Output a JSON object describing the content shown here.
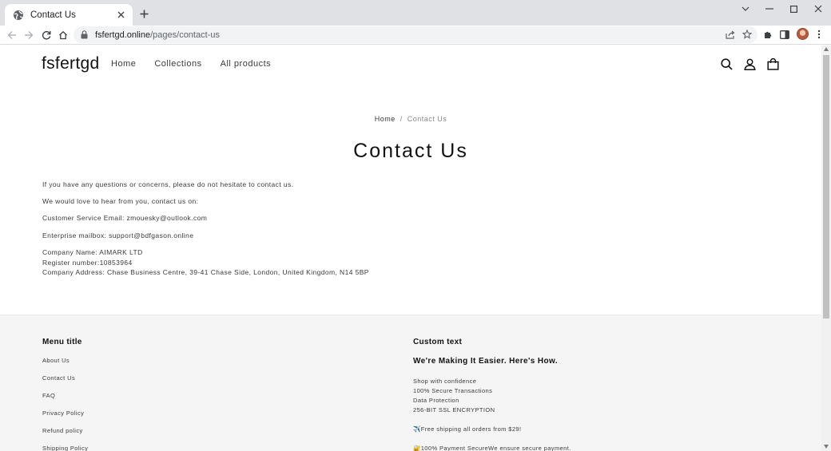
{
  "browser": {
    "tab_title": "Contact Us",
    "url_domain": "fsfertgd.online",
    "url_path": "/pages/contact-us"
  },
  "header": {
    "logo": "fsfertgd",
    "nav": [
      "Home",
      "Collections",
      "All products"
    ]
  },
  "breadcrumb": {
    "home": "Home",
    "separator": "/",
    "current": "Contact Us"
  },
  "page": {
    "title": "Contact Us",
    "paragraphs": [
      "If you have any questions or concerns, please do not hesitate to contact us.",
      "We would love to hear from you, contact us on:",
      "Customer Service Email: zmouesky@outlook.com",
      "Enterprise mailbox: support@bdfgason.online"
    ],
    "company": [
      "Company Name: AIMARK LTD",
      "Register number:10853964",
      "Company Address: Chase Business Centre, 39-41 Chase Side, London, United Kingdom, N14 5BP"
    ]
  },
  "footer": {
    "menu_title": "Menu title",
    "menu_items": [
      "About Us",
      "Contact Us",
      "FAQ",
      "Privacy Policy",
      "Refund policy",
      "Shipping Policy"
    ],
    "custom_title": "Custom text",
    "custom_heading": "We're Making It Easier. Here's How.",
    "custom_lines": [
      "Shop with confidence",
      "100% Secure Transactions",
      "Data Protection",
      "256-BIT SSL ENCRYPTION"
    ],
    "shipping_line": "✈️Free shipping all orders from $29!",
    "payment_line": "🔐100% Payment SecureWe ensure secure payment."
  },
  "colors": {
    "tabstrip": "#dfe1e5",
    "footer_bg": "#f5f5f5",
    "text": "#121212"
  },
  "icons": [
    "globe-icon",
    "close-icon",
    "plus-icon",
    "back-icon",
    "forward-icon",
    "reload-icon",
    "home-icon",
    "lock-icon",
    "share-icon",
    "star-icon",
    "extensions-icon",
    "sidepanel-icon",
    "menu-icon",
    "search-icon",
    "account-icon",
    "cart-icon"
  ]
}
